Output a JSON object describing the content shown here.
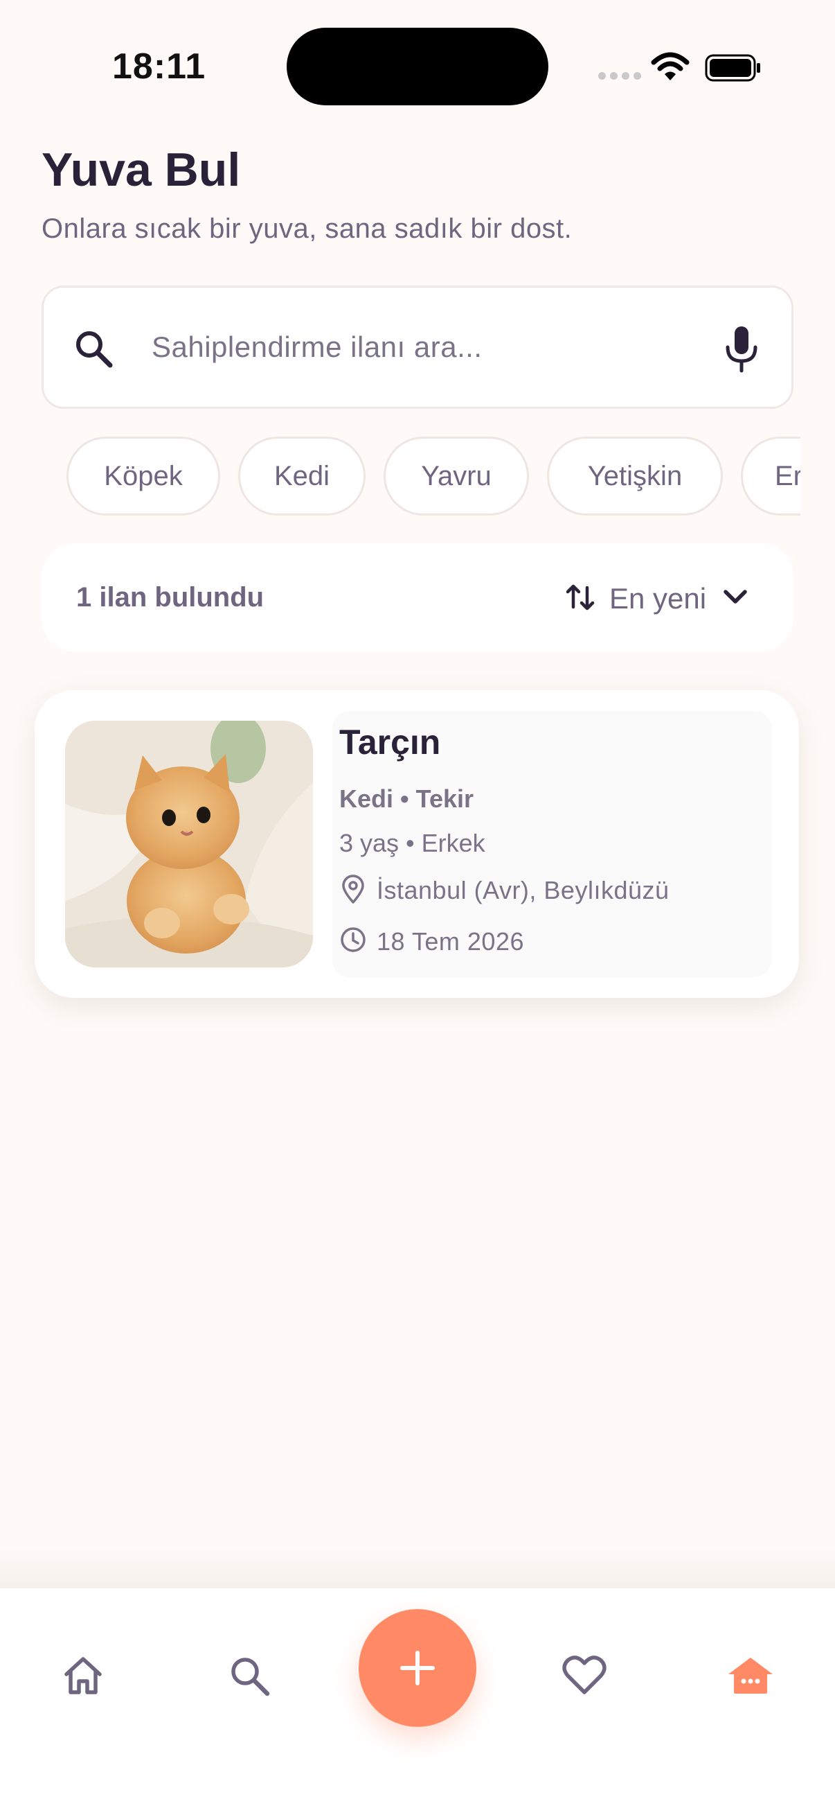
{
  "status_bar": {
    "time": "18:11"
  },
  "header": {
    "title": "Yuva Bul",
    "subtitle": "Onlara sıcak bir yuva, sana sadık bir dost."
  },
  "search": {
    "placeholder": "Sahiplendirme ilanı ara...",
    "value": ""
  },
  "filters": {
    "chips": [
      {
        "label": "Köpek"
      },
      {
        "label": "Kedi"
      },
      {
        "label": "Yavru"
      },
      {
        "label": "Yetişkin"
      },
      {
        "label": "Er"
      }
    ]
  },
  "results": {
    "count_text": "1 ilan bulundu",
    "sort_label": "En yeni"
  },
  "listings": [
    {
      "name": "Tarçın",
      "species": "Kedi • Tekir",
      "details": "3 yaş • Erkek",
      "location": "İstanbul (Avr), Beylıkdüzü",
      "date": "18 Tem 2026"
    }
  ],
  "nav": {
    "active": "shelter",
    "items": [
      {
        "icon": "home-icon"
      },
      {
        "icon": "search-icon"
      },
      {
        "icon": "plus-icon"
      },
      {
        "icon": "heart-icon"
      },
      {
        "icon": "pet-house-icon"
      }
    ]
  },
  "colors": {
    "accent": "#FF8A65",
    "background": "#FFFAF7",
    "text_primary": "#2A2238",
    "text_secondary": "#6E6680"
  }
}
